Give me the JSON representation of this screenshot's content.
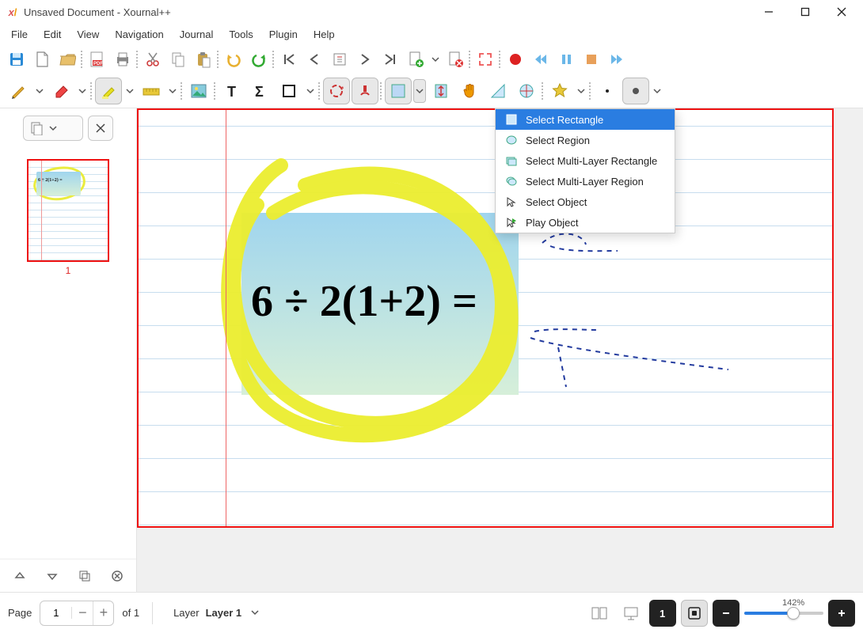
{
  "window": {
    "title": "Unsaved Document - Xournal++"
  },
  "menu": {
    "items": [
      "File",
      "Edit",
      "View",
      "Navigation",
      "Journal",
      "Tools",
      "Plugin",
      "Help"
    ]
  },
  "dropdown": {
    "items": [
      {
        "label": "Select Rectangle"
      },
      {
        "label": "Select Region"
      },
      {
        "label": "Select Multi-Layer Rectangle"
      },
      {
        "label": "Select Multi-Layer Region"
      },
      {
        "label": "Select Object"
      },
      {
        "label": "Play Object"
      }
    ]
  },
  "sidebar": {
    "page_number": "1"
  },
  "canvas": {
    "equation": "6 ÷ 2(1+2) ="
  },
  "status": {
    "page_label": "Page",
    "page_current": "1",
    "page_total": "of 1",
    "layer_label": "Layer",
    "layer_value": "Layer 1",
    "zoom": "142%"
  }
}
